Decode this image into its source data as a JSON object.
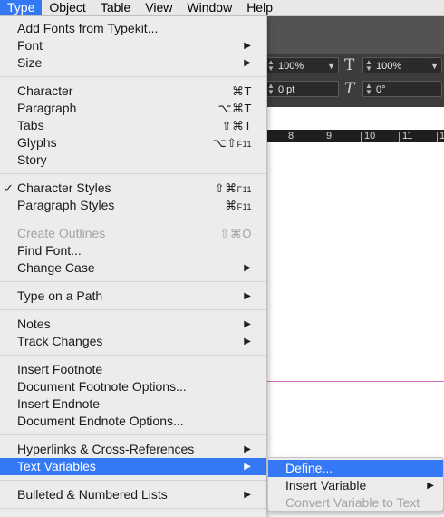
{
  "menubar": {
    "items": [
      {
        "label": "Type",
        "active": true
      },
      {
        "label": "Object"
      },
      {
        "label": "Table"
      },
      {
        "label": "View"
      },
      {
        "label": "Window"
      },
      {
        "label": "Help"
      }
    ]
  },
  "control_panel": {
    "leading_value": "100%",
    "scale_value": "100%",
    "tracking_value": "0 pt",
    "skew_value": "0°"
  },
  "ruler": {
    "labels": [
      "8",
      "9",
      "10",
      "11",
      "1"
    ]
  },
  "type_menu": {
    "add_fonts": "Add Fonts from Typekit...",
    "font": "Font",
    "size": "Size",
    "character": "Character",
    "character_sc": "⌘T",
    "paragraph": "Paragraph",
    "paragraph_sc": "⌥⌘T",
    "tabs": "Tabs",
    "tabs_sc": "⇧⌘T",
    "glyphs": "Glyphs",
    "glyphs_sc": "⌥⇧",
    "glyphs_sc_key": "F11",
    "story": "Story",
    "character_styles": "Character Styles",
    "character_styles_sc": "⇧⌘",
    "character_styles_sc_key": "F11",
    "character_styles_checked": "✓",
    "paragraph_styles": "Paragraph Styles",
    "paragraph_styles_sc": "⌘",
    "paragraph_styles_sc_key": "F11",
    "create_outlines": "Create Outlines",
    "create_outlines_sc": "⇧⌘O",
    "find_font": "Find Font...",
    "change_case": "Change Case",
    "type_on_path": "Type on a Path",
    "notes": "Notes",
    "track_changes": "Track Changes",
    "insert_footnote": "Insert Footnote",
    "doc_footnote_options": "Document Footnote Options...",
    "insert_endnote": "Insert Endnote",
    "doc_endnote_options": "Document Endnote Options...",
    "hyperlinks": "Hyperlinks & Cross-References",
    "text_variables": "Text Variables",
    "bulleted_lists": "Bulleted & Numbered Lists"
  },
  "text_variables_submenu": {
    "define": "Define...",
    "insert_variable": "Insert Variable",
    "convert_variable": "Convert Variable to Text"
  }
}
